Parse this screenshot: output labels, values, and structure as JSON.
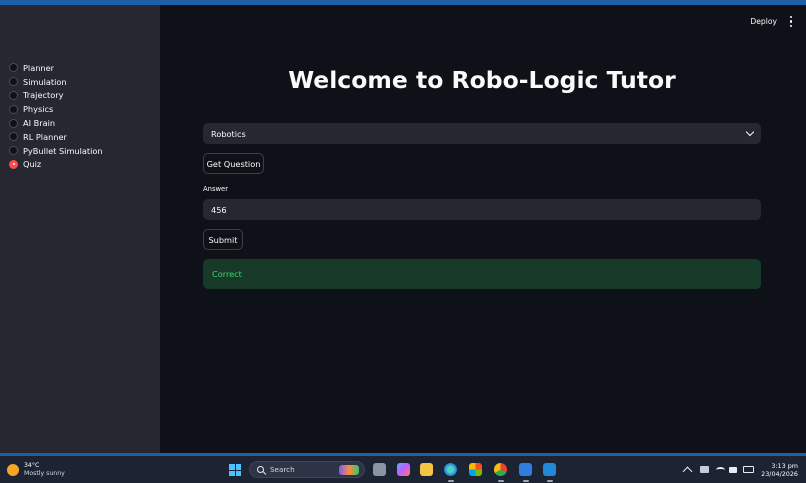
{
  "sidebar": {
    "items": [
      {
        "label": "Planner",
        "selected": false
      },
      {
        "label": "Simulation",
        "selected": false
      },
      {
        "label": "Trajectory",
        "selected": false
      },
      {
        "label": "Physics",
        "selected": false
      },
      {
        "label": "AI Brain",
        "selected": false
      },
      {
        "label": "RL Planner",
        "selected": false
      },
      {
        "label": "PyBullet Simulation",
        "selected": false
      },
      {
        "label": "Quiz",
        "selected": true
      }
    ]
  },
  "header": {
    "deploy_label": "Deploy",
    "menu_icon": "kebab-menu-icon"
  },
  "main": {
    "title": "Welcome to Robo-Logic Tutor",
    "topic_select": {
      "selected": "Robotics"
    },
    "get_question_label": "Get Question",
    "answer_label": "Answer",
    "answer_value": "456",
    "submit_label": "Submit",
    "result_message": "Correct"
  },
  "taskbar": {
    "weather_temp": "34°C",
    "weather_desc": "Mostly sunny",
    "search_placeholder": "Search",
    "time": "3:13 pm",
    "date": "23/04/2026"
  },
  "colors": {
    "accent": "#ff4b4b",
    "app_background": "#0e1117",
    "sidebar_background": "#262730",
    "success_background": "#173928",
    "success_text": "#3dd56d",
    "taskbar_background": "#1c2333"
  }
}
